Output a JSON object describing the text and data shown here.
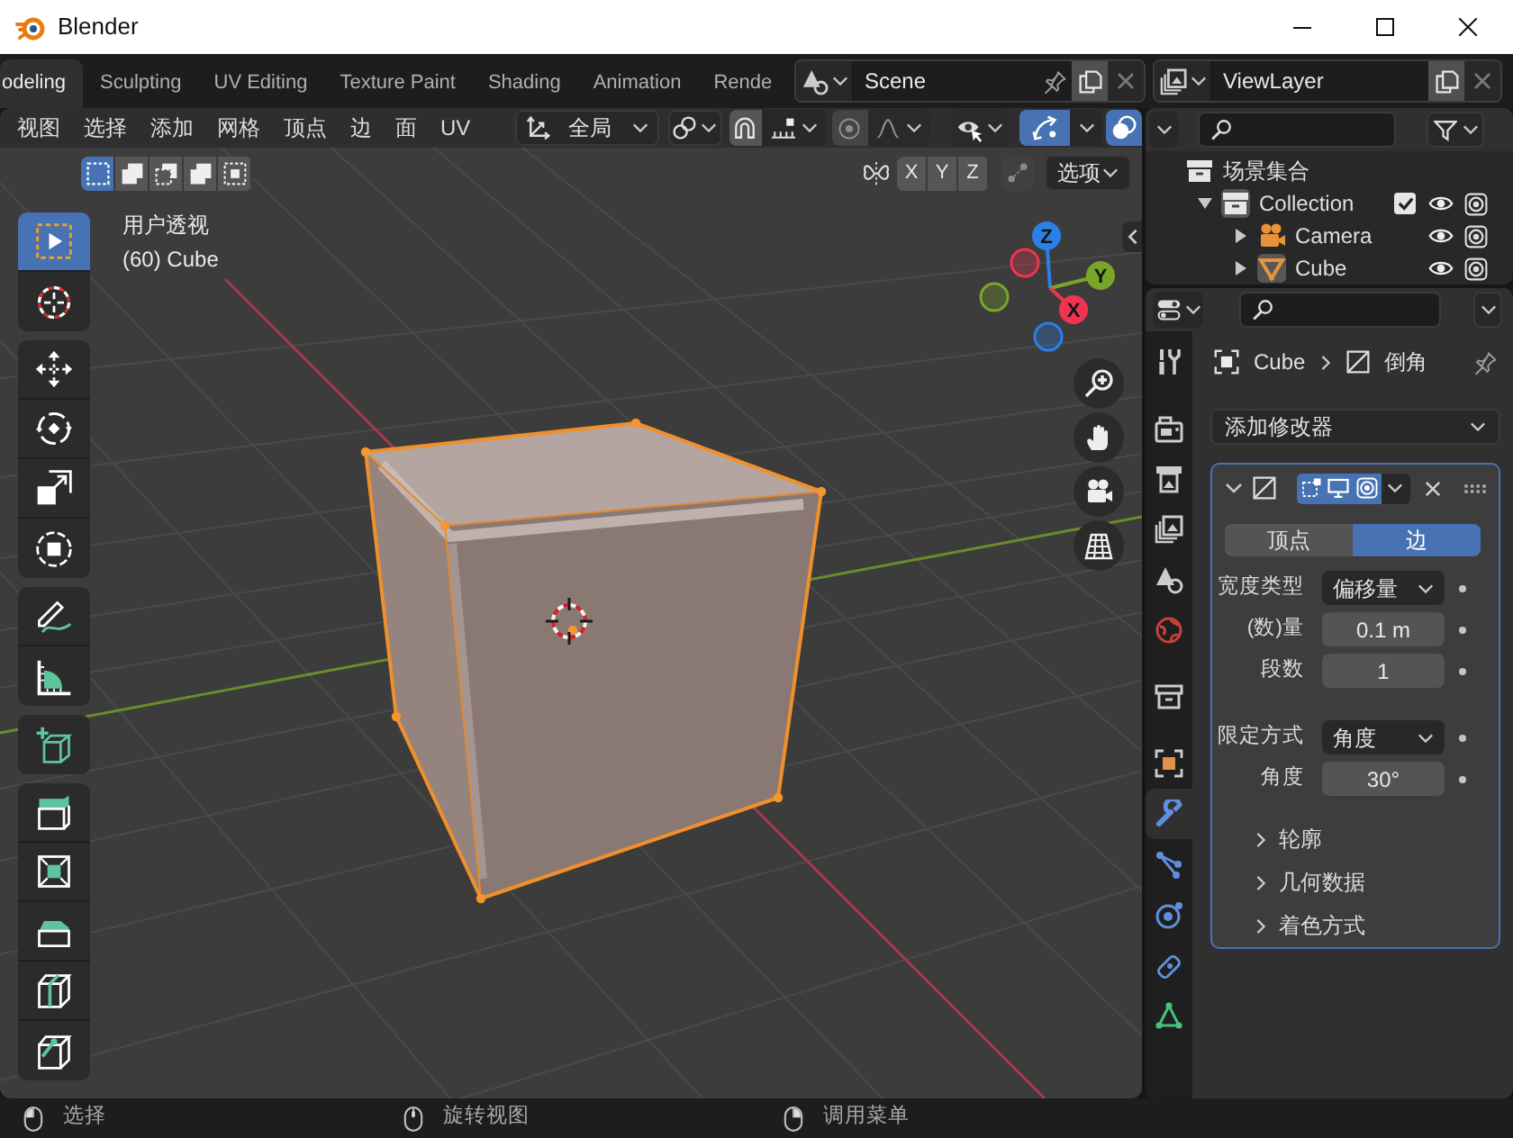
{
  "window": {
    "title": "Blender"
  },
  "workspace_tabs": [
    {
      "label": "odeling",
      "selected": true
    },
    {
      "label": "Sculpting",
      "selected": false
    },
    {
      "label": "UV Editing",
      "selected": false
    },
    {
      "label": "Texture Paint",
      "selected": false
    },
    {
      "label": "Shading",
      "selected": false
    },
    {
      "label": "Animation",
      "selected": false
    },
    {
      "label": "Rende",
      "selected": false
    }
  ],
  "scene_selector": {
    "value": "Scene"
  },
  "view_layer_selector": {
    "value": "ViewLayer"
  },
  "viewport": {
    "menus": [
      "视图",
      "选择",
      "添加",
      "网格",
      "顶点",
      "边",
      "面",
      "UV"
    ],
    "orientation": "全局",
    "header_toggles": [
      {
        "kind": "snap",
        "on": false
      },
      {
        "kind": "proportional",
        "on": false
      },
      {
        "kind": "gizmos",
        "on": true
      },
      {
        "kind": "overlays",
        "on": true
      }
    ],
    "select_modes": [
      {
        "kind": "set",
        "selected": true
      },
      {
        "kind": "extend",
        "selected": false
      },
      {
        "kind": "subtract",
        "selected": false
      },
      {
        "kind": "invert",
        "selected": false
      },
      {
        "kind": "intersect",
        "selected": false
      }
    ],
    "mirror_axes": [
      {
        "label": "X",
        "on": false
      },
      {
        "label": "Y",
        "on": false
      },
      {
        "label": "Z",
        "on": false
      }
    ],
    "auto_merge": {
      "on": false
    },
    "options": "选项",
    "view_name": "用户透视",
    "active_object": "(60) Cube",
    "tool_groups": [
      [
        {
          "kind": "select_box",
          "selected": true
        },
        {
          "kind": "cursor",
          "selected": false
        }
      ],
      [
        {
          "kind": "move",
          "selected": false
        },
        {
          "kind": "rotate",
          "selected": false
        },
        {
          "kind": "scale",
          "selected": false
        },
        {
          "kind": "transform",
          "selected": false
        }
      ],
      [
        {
          "kind": "annotate",
          "selected": false
        },
        {
          "kind": "measure",
          "selected": false
        }
      ],
      [
        {
          "kind": "add_cube",
          "selected": false
        }
      ],
      [
        {
          "kind": "extrude",
          "selected": false
        },
        {
          "kind": "inset",
          "selected": false
        },
        {
          "kind": "bevel",
          "selected": false
        },
        {
          "kind": "loop_cut",
          "selected": false
        },
        {
          "kind": "knife",
          "selected": false
        }
      ]
    ],
    "nav_gizmo": [
      {
        "label": "Z",
        "color": "#2c7fe6"
      },
      {
        "label": "Y",
        "color": "#79a628"
      },
      {
        "label": "X",
        "color": "#f0344f"
      }
    ]
  },
  "outliner": {
    "tree": [
      {
        "kind": "scene_collection",
        "label": "场景集合",
        "active": false,
        "children": [
          {
            "kind": "collection",
            "label": "Collection",
            "active": true,
            "expanded": true,
            "checked": true,
            "children": [
              {
                "kind": "camera",
                "label": "Camera",
                "active": false,
                "expanded": false
              },
              {
                "kind": "mesh",
                "label": "Cube",
                "active": true,
                "expanded": false
              }
            ]
          }
        ]
      }
    ]
  },
  "properties": {
    "tab_groups": [
      [
        {
          "kind": "tool",
          "selected": false
        }
      ],
      [
        {
          "kind": "render",
          "selected": false
        },
        {
          "kind": "output",
          "selected": false
        },
        {
          "kind": "view_layer",
          "selected": false
        },
        {
          "kind": "scene",
          "selected": false
        },
        {
          "kind": "world",
          "selected": false
        }
      ],
      [
        {
          "kind": "collection",
          "selected": false
        }
      ],
      [
        {
          "kind": "object",
          "selected": false
        },
        {
          "kind": "modifiers",
          "selected": true
        },
        {
          "kind": "particles",
          "selected": false
        },
        {
          "kind": "physics",
          "selected": false
        },
        {
          "kind": "constraints",
          "selected": false
        },
        {
          "kind": "data",
          "selected": false
        }
      ]
    ],
    "breadcrumb": [
      "Cube",
      "倒角"
    ],
    "add_modifier": "添加修改器",
    "modifier": {
      "expanded": true,
      "toggles": [
        {
          "kind": "edit_mode",
          "on": true
        },
        {
          "kind": "viewport",
          "on": true
        },
        {
          "kind": "render",
          "on": true
        }
      ],
      "affect": [
        {
          "label": "顶点",
          "selected": false
        },
        {
          "label": "边",
          "selected": true
        }
      ],
      "field_groups": [
        [
          {
            "kind": "dropdown",
            "label": "宽度类型",
            "value": "偏移量"
          },
          {
            "kind": "number",
            "label": "(数)量",
            "value": "0.1 m"
          },
          {
            "kind": "number",
            "label": "段数",
            "value": "1"
          }
        ],
        [
          {
            "kind": "dropdown",
            "label": "限定方式",
            "value": "角度"
          },
          {
            "kind": "number",
            "label": "角度",
            "value": "30°"
          }
        ]
      ],
      "subpanels": [
        {
          "label": "轮廓",
          "expanded": false
        },
        {
          "label": "几何数据",
          "expanded": false
        },
        {
          "label": "着色方式",
          "expanded": false
        }
      ]
    }
  },
  "status_bar": [
    {
      "kind": "left",
      "label": "选择"
    },
    {
      "kind": "middle",
      "label": "旋转视图"
    },
    {
      "kind": "right",
      "label": "调用菜单"
    }
  ]
}
